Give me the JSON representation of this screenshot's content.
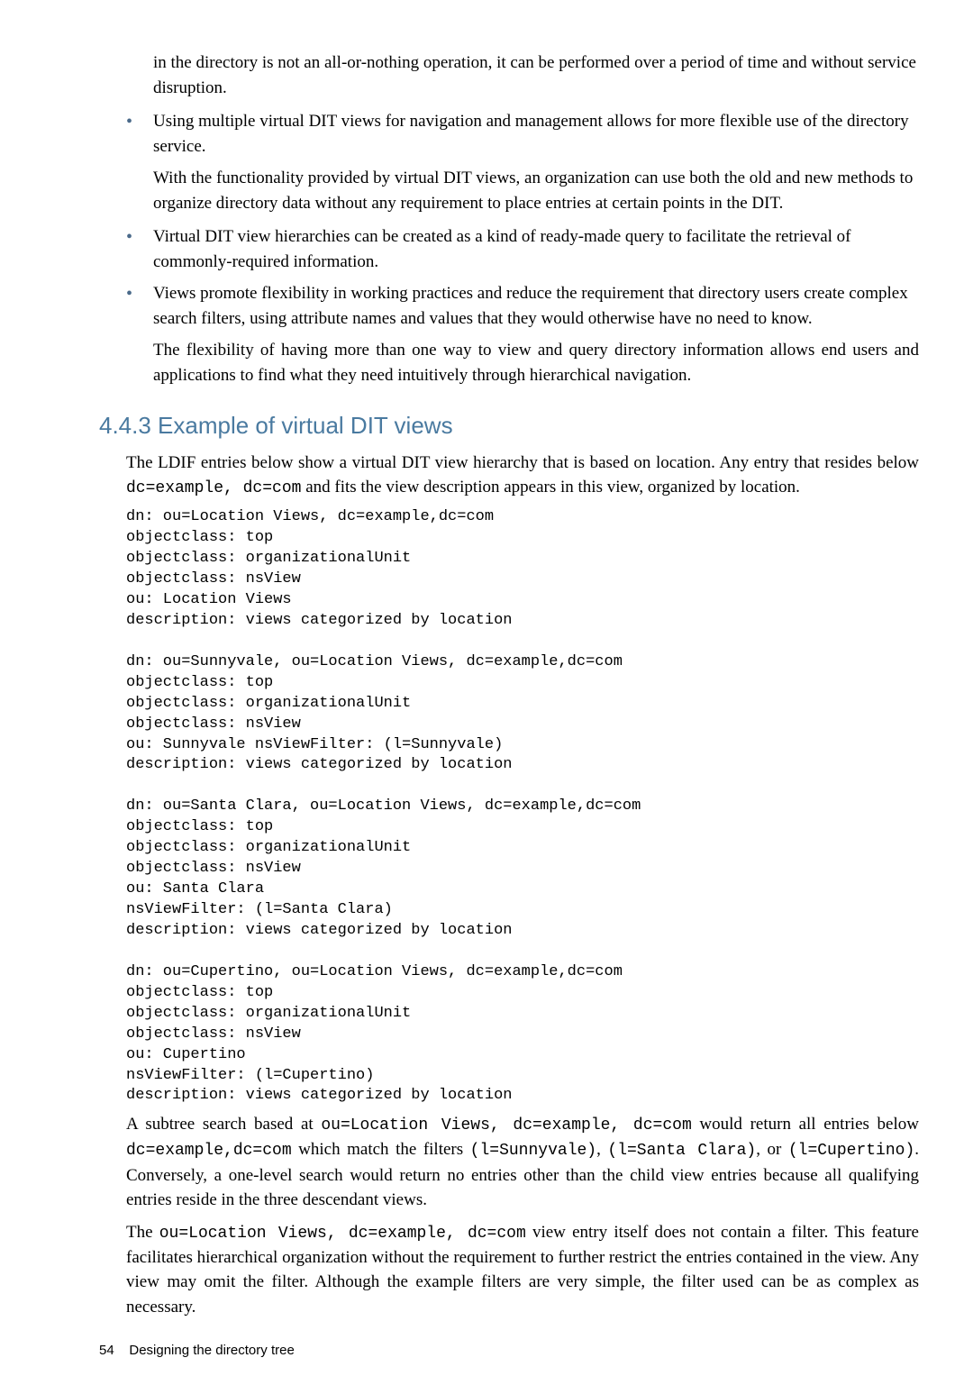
{
  "intro_continuation": "in the directory is not an all-or-nothing operation, it can be performed over a period of time and without service disruption.",
  "bullets": [
    {
      "text": "Using multiple virtual DIT views for navigation and management allows for more flexible use of the directory service.",
      "sub": "With the functionality provided by virtual DIT views, an organization can use both the old and new methods to organize directory data without any requirement to place entries at certain points in the DIT."
    },
    {
      "text": "Virtual DIT view hierarchies can be created as a kind of ready-made query to facilitate the retrieval of commonly-required information.",
      "sub": null
    },
    {
      "text": "Views promote flexibility in working practices and reduce the requirement that directory users create complex search filters, using attribute names and values that they would otherwise have no need to know.",
      "sub": "The flexibility of having more than one way to view and query directory information allows end users and applications to find what they need intuitively through hierarchical navigation."
    }
  ],
  "section_heading": "4.4.3 Example of virtual DIT views",
  "section_intro": {
    "pre": "The LDIF entries below show a virtual DIT view hierarchy that is based on location. Any entry that resides below ",
    "code": "dc=example, dc=com",
    "post": " and fits the view description appears in this view, organized by location."
  },
  "ldif": "dn: ou=Location Views, dc=example,dc=com\nobjectclass: top\nobjectclass: organizationalUnit\nobjectclass: nsView\nou: Location Views\ndescription: views categorized by location\n\ndn: ou=Sunnyvale, ou=Location Views, dc=example,dc=com\nobjectclass: top\nobjectclass: organizationalUnit\nobjectclass: nsView\nou: Sunnyvale nsViewFilter: (l=Sunnyvale)\ndescription: views categorized by location\n\ndn: ou=Santa Clara, ou=Location Views, dc=example,dc=com\nobjectclass: top\nobjectclass: organizationalUnit\nobjectclass: nsView\nou: Santa Clara\nnsViewFilter: (l=Santa Clara)\ndescription: views categorized by location\n\ndn: ou=Cupertino, ou=Location Views, dc=example,dc=com\nobjectclass: top\nobjectclass: organizationalUnit\nobjectclass: nsView\nou: Cupertino\nnsViewFilter: (l=Cupertino)\ndescription: views categorized by location",
  "after1": {
    "t1": "A subtree search based at ",
    "c1": "ou=Location Views, dc=example, dc=com",
    "t2": " would return all entries below ",
    "c2": "dc=example,dc=com",
    "t3": " which match the filters ",
    "c3": "(l=Sunnyvale)",
    "t4": ", ",
    "c4": "(l=Santa Clara)",
    "t5": ", or ",
    "c5": "(l=Cupertino)",
    "t6": ". Conversely, a one-level search would return no entries other than the child view entries because all qualifying entries reside in the three descendant views."
  },
  "after2": {
    "t1": "The ",
    "c1": "ou=Location Views, dc=example, dc=com",
    "t2": " view entry itself does not contain a filter. This feature facilitates hierarchical organization without the requirement to further restrict the entries contained in the view. Any view may omit the filter. Although the example filters are very simple, the filter used can be as complex as necessary."
  },
  "footer": {
    "page": "54",
    "title": "Designing the directory tree"
  }
}
